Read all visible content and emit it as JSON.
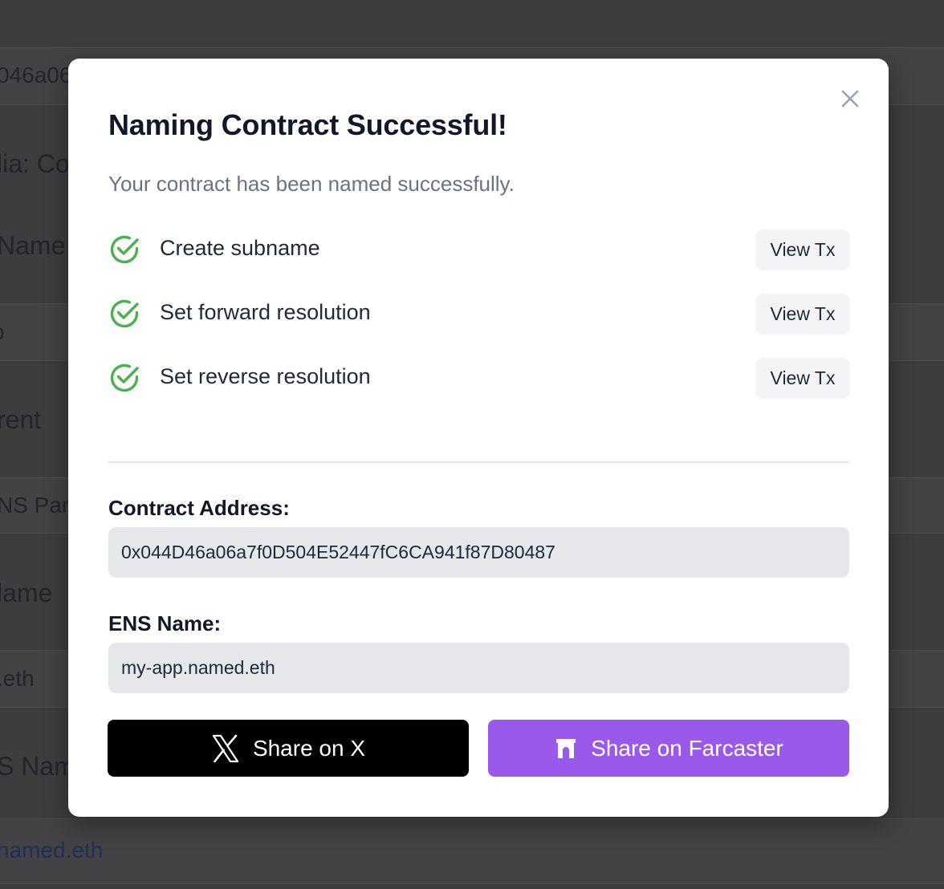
{
  "background": {
    "fragments": [
      "046a06",
      "lia: Co",
      " Name",
      "o",
      "rent",
      "NS Pare",
      "lame",
      ".eth",
      "S Name",
      "named.eth"
    ]
  },
  "modal": {
    "title": "Naming Contract Successful!",
    "subtitle": "Your contract has been named successfully.",
    "steps": [
      {
        "label": "Create subname",
        "status": "complete",
        "action": "View Tx"
      },
      {
        "label": "Set forward resolution",
        "status": "complete",
        "action": "View Tx"
      },
      {
        "label": "Set reverse resolution",
        "status": "complete",
        "action": "View Tx"
      }
    ],
    "contract_address": {
      "label": "Contract Address:",
      "value": "0x044D46a06a7f0D504E52447fC6CA941f87D80487"
    },
    "ens_name": {
      "label": "ENS Name:",
      "value": "my-app.named.eth"
    },
    "share_x": {
      "label": "Share on X",
      "icon": "x-logo-icon",
      "color": "#000000"
    },
    "share_farcaster": {
      "label": "Share on Farcaster",
      "icon": "farcaster-logo-icon",
      "color": "#9b59ec"
    }
  },
  "colors": {
    "success": "#4caf50",
    "overlay": "#3d3d3e"
  }
}
